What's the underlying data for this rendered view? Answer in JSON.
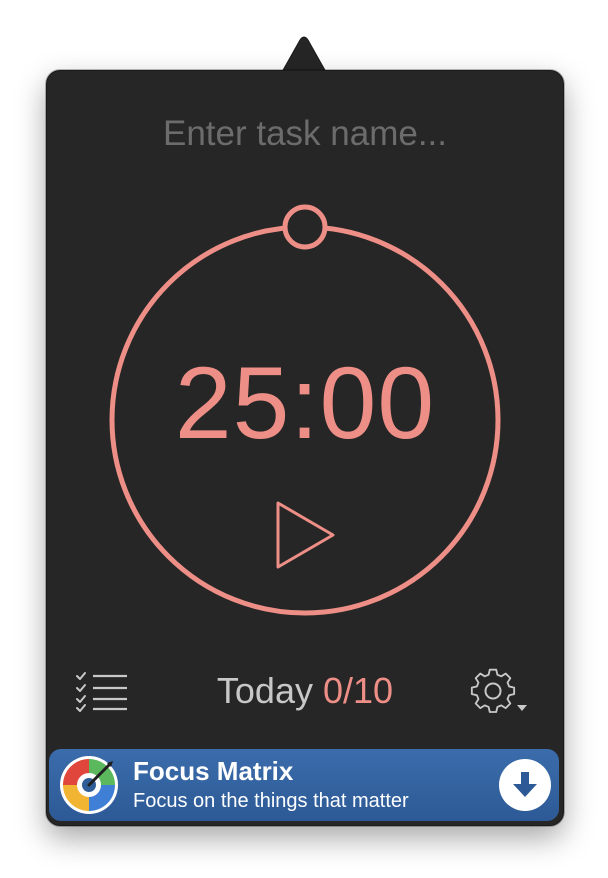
{
  "task": {
    "placeholder": "Enter task name...",
    "value": ""
  },
  "timer": {
    "time": "25:00",
    "progress": 0,
    "icons": {
      "play": "play-icon",
      "handle": "progress-handle"
    }
  },
  "footer": {
    "today_label": "Today",
    "today_count": "0/10",
    "icons": {
      "list": "task-list-icon",
      "settings": "gear-icon"
    }
  },
  "banner": {
    "title": "Focus Matrix",
    "subtitle": "Focus on the things that matter",
    "icons": {
      "logo": "focus-matrix-logo",
      "download": "download-icon"
    },
    "background": "#2f5d98"
  },
  "colors": {
    "accent": "#ee8f87",
    "panel": "#262626",
    "placeholder": "#6c6c6c",
    "muted": "#c8c8c8"
  }
}
